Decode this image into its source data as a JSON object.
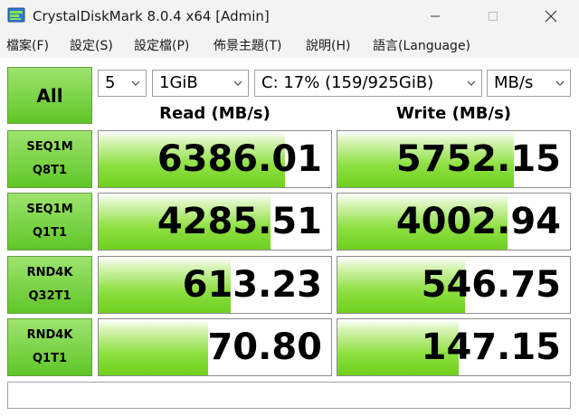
{
  "window": {
    "title": "CrystalDiskMark 8.0.4 x64 [Admin]"
  },
  "menu": {
    "file": "檔案(F)",
    "settings": "設定(S)",
    "profile": "設定檔(P)",
    "theme": "佈景主題(T)",
    "help": "說明(H)",
    "language": "語言(Language)"
  },
  "controls": {
    "all_label": "All",
    "count": "5",
    "size": "1GiB",
    "drive": "C: 17% (159/925GiB)",
    "unit": "MB/s"
  },
  "headers": {
    "read": "Read (MB/s)",
    "write": "Write (MB/s)"
  },
  "rows": [
    {
      "line1": "SEQ1M",
      "line2": "Q8T1",
      "read": "6386.01",
      "write": "5752.15",
      "read_fill": 0.8,
      "write_fill": 0.76
    },
    {
      "line1": "SEQ1M",
      "line2": "Q1T1",
      "read": "4285.51",
      "write": "4002.94",
      "read_fill": 0.74,
      "write_fill": 0.73
    },
    {
      "line1": "RND4K",
      "line2": "Q32T1",
      "read": "613.23",
      "write": "546.75",
      "read_fill": 0.57,
      "write_fill": 0.55
    },
    {
      "line1": "RND4K",
      "line2": "Q1T1",
      "read": "70.80",
      "write": "147.15",
      "read_fill": 0.47,
      "write_fill": 0.52
    }
  ],
  "comment": "",
  "colors": {
    "accent_green": "#5fc628",
    "bar_green": "#8fe042",
    "titlebar_bg": "#f3f3f3"
  }
}
